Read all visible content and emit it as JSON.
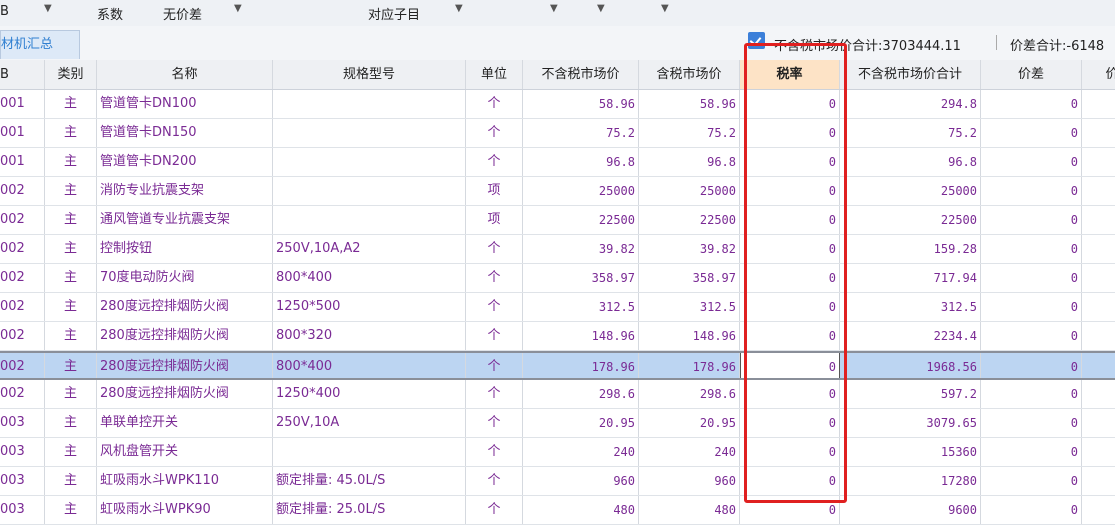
{
  "topbar": {
    "col1_label": "B",
    "coefficient_label": "系数",
    "no_price_diff_label": "无价差",
    "sub_item_label": "对应子目"
  },
  "tabbar": {
    "tab_label": "材机汇总",
    "sum_excl_tax": "不含税市场价合计:3703444.11",
    "diff_sum": "价差合计:-6148"
  },
  "table": {
    "headers": {
      "code": "B",
      "category": "类别",
      "name": "名称",
      "spec": "规格型号",
      "unit": "单位",
      "price_excl": "不含税市场价",
      "price_incl": "含税市场价",
      "rate": "税率",
      "total_excl": "不含税市场价合计",
      "diff": "价差",
      "extra": "价"
    },
    "rows": [
      {
        "code": "001",
        "cat": "主",
        "name": "管道管卡DN100",
        "spec": "",
        "unit": "个",
        "pe": "58.96",
        "pi": "58.96",
        "rate": "0",
        "total": "294.8",
        "diff": "0"
      },
      {
        "code": "001",
        "cat": "主",
        "name": "管道管卡DN150",
        "spec": "",
        "unit": "个",
        "pe": "75.2",
        "pi": "75.2",
        "rate": "0",
        "total": "75.2",
        "diff": "0"
      },
      {
        "code": "001",
        "cat": "主",
        "name": "管道管卡DN200",
        "spec": "",
        "unit": "个",
        "pe": "96.8",
        "pi": "96.8",
        "rate": "0",
        "total": "96.8",
        "diff": "0"
      },
      {
        "code": "002",
        "cat": "主",
        "name": "消防专业抗震支架",
        "spec": "",
        "unit": "项",
        "pe": "25000",
        "pi": "25000",
        "rate": "0",
        "total": "25000",
        "diff": "0"
      },
      {
        "code": "002",
        "cat": "主",
        "name": "通风管道专业抗震支架",
        "spec": "",
        "unit": "项",
        "pe": "22500",
        "pi": "22500",
        "rate": "0",
        "total": "22500",
        "diff": "0"
      },
      {
        "code": "002",
        "cat": "主",
        "name": "控制按钮",
        "spec": "250V,10A,A2",
        "unit": "个",
        "pe": "39.82",
        "pi": "39.82",
        "rate": "0",
        "total": "159.28",
        "diff": "0"
      },
      {
        "code": "002",
        "cat": "主",
        "name": "70度电动防火阀",
        "spec": "800*400",
        "unit": "个",
        "pe": "358.97",
        "pi": "358.97",
        "rate": "0",
        "total": "717.94",
        "diff": "0"
      },
      {
        "code": "002",
        "cat": "主",
        "name": "280度远控排烟防火阀",
        "spec": "1250*500",
        "unit": "个",
        "pe": "312.5",
        "pi": "312.5",
        "rate": "0",
        "total": "312.5",
        "diff": "0"
      },
      {
        "code": "002",
        "cat": "主",
        "name": "280度远控排烟防火阀",
        "spec": "800*320",
        "unit": "个",
        "pe": "148.96",
        "pi": "148.96",
        "rate": "0",
        "total": "2234.4",
        "diff": "0"
      },
      {
        "code": "002",
        "cat": "主",
        "name": "280度远控排烟防火阀",
        "spec": "800*400",
        "unit": "个",
        "pe": "178.96",
        "pi": "178.96",
        "rate": "0",
        "total": "1968.56",
        "diff": "0"
      },
      {
        "code": "002",
        "cat": "主",
        "name": "280度远控排烟防火阀",
        "spec": "1250*400",
        "unit": "个",
        "pe": "298.6",
        "pi": "298.6",
        "rate": "0",
        "total": "597.2",
        "diff": "0"
      },
      {
        "code": "003",
        "cat": "主",
        "name": "单联单控开关",
        "spec": "250V,10A",
        "unit": "个",
        "pe": "20.95",
        "pi": "20.95",
        "rate": "0",
        "total": "3079.65",
        "diff": "0"
      },
      {
        "code": "003",
        "cat": "主",
        "name": "风机盘管开关",
        "spec": "",
        "unit": "个",
        "pe": "240",
        "pi": "240",
        "rate": "0",
        "total": "15360",
        "diff": "0"
      },
      {
        "code": "003",
        "cat": "主",
        "name": "虹吸雨水斗WPK110",
        "spec": "额定排量: 45.0L/S",
        "unit": "个",
        "pe": "960",
        "pi": "960",
        "rate": "0",
        "total": "17280",
        "diff": "0"
      },
      {
        "code": "003",
        "cat": "主",
        "name": "虹吸雨水斗WPK90",
        "spec": "额定排量: 25.0L/S",
        "unit": "个",
        "pe": "480",
        "pi": "480",
        "rate": "0",
        "total": "9600",
        "diff": "0"
      }
    ]
  }
}
